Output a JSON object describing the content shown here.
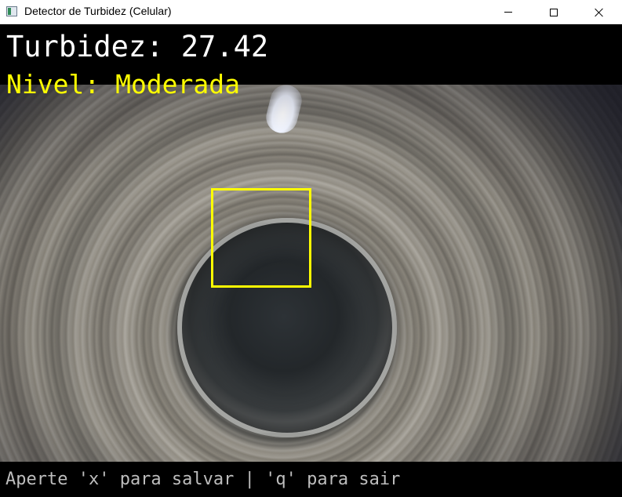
{
  "window": {
    "title": "Detector de Turbidez (Celular)",
    "icon": "app-window-icon",
    "controls": [
      "minimize",
      "maximize",
      "close"
    ]
  },
  "overlay": {
    "turbidity_text": "Turbidez: 27.42",
    "level_text": "Nivel: Moderada",
    "hint_text": "Aperte 'x' para salvar | 'q' para sair",
    "colors": {
      "turbidity": "#ffffff",
      "level": "#ffff00",
      "roi_box": "#ffff00",
      "hint": "#bdbdbd"
    }
  }
}
